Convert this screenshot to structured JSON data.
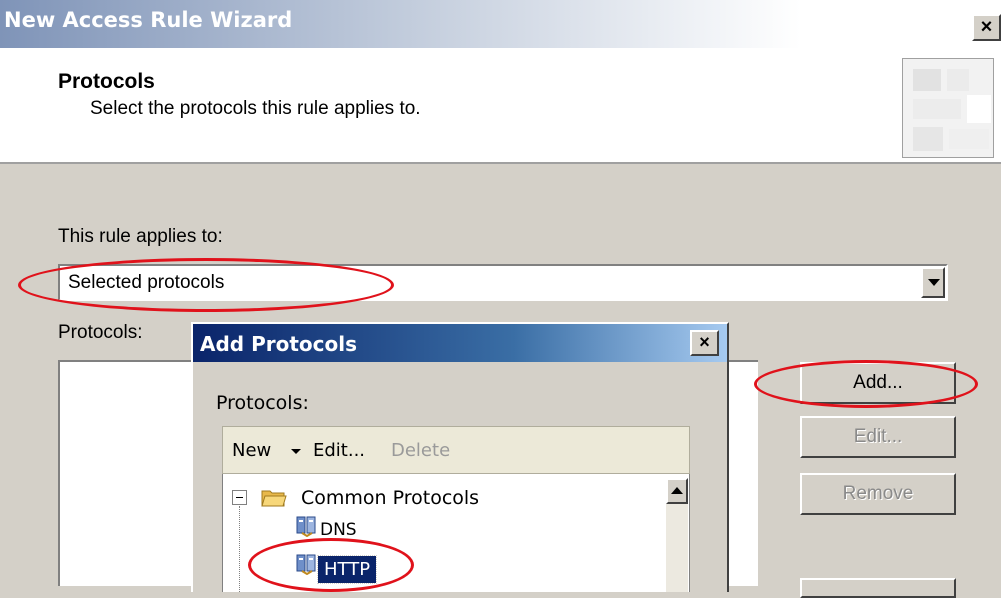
{
  "window": {
    "title": "New Access Rule Wizard",
    "close_label": "×"
  },
  "header": {
    "title": "Protocols",
    "subtitle": "Select the protocols this rule applies to."
  },
  "rule": {
    "label": "This rule applies to:",
    "selected": "Selected protocols"
  },
  "protocols_panel": {
    "label": "Protocols:",
    "buttons": {
      "add": "Add...",
      "edit": "Edit...",
      "remove": "Remove"
    }
  },
  "dialog": {
    "title": "Add Protocols",
    "close_label": "×",
    "protocols_label": "Protocols:",
    "toolbar": {
      "new": "New",
      "edit": "Edit...",
      "delete": "Delete"
    },
    "tree": {
      "group": "Common Protocols",
      "items": [
        {
          "label": "DNS",
          "selected": false
        },
        {
          "label": "HTTP",
          "selected": true
        }
      ]
    }
  },
  "annotations": {
    "color": "#e0121b"
  },
  "colors": {
    "title_gradient_start": "#7f94b8",
    "dialog_title": "#0a246a",
    "selection": "#0a246a"
  }
}
